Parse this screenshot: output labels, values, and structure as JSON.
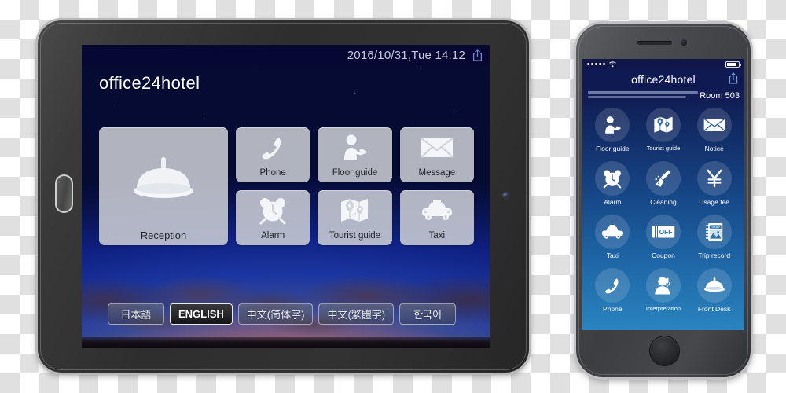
{
  "tablet": {
    "status_bar": {
      "datetime": "2016/10/31,Tue 14:12",
      "share_icon": "share-icon"
    },
    "brand": "office24hotel",
    "tiles": [
      {
        "label": "Reception",
        "icon": "service-bell-icon",
        "size": "large"
      },
      {
        "label": "Phone",
        "icon": "phone-handset-icon",
        "size": "small"
      },
      {
        "label": "Floor guide",
        "icon": "concierge-person-icon",
        "size": "small"
      },
      {
        "label": "Message",
        "icon": "envelope-icon",
        "size": "small"
      },
      {
        "label": "Alarm",
        "icon": "alarm-clock-icon",
        "size": "small"
      },
      {
        "label": "Tourist guide",
        "icon": "map-pins-icon",
        "size": "small"
      },
      {
        "label": "Taxi",
        "icon": "taxi-car-icon",
        "size": "small"
      }
    ],
    "languages": [
      {
        "label": "日本語",
        "selected": false
      },
      {
        "label": "ENGLISH",
        "selected": true
      },
      {
        "label": "中文(简体字)",
        "selected": false
      },
      {
        "label": "中文(繁體字)",
        "selected": false
      },
      {
        "label": "한국어",
        "selected": false
      }
    ]
  },
  "phone": {
    "status_bar": {
      "signal_dots": 5,
      "wifi_icon": "wifi-icon",
      "battery_icon": "battery-icon"
    },
    "nav": {
      "title": "office24hotel",
      "share_icon": "share-icon"
    },
    "room": "Room 503",
    "tiles": [
      {
        "label": "Floor guide",
        "icon": "concierge-person-icon"
      },
      {
        "label": "Tourist guide",
        "icon": "map-pins-icon"
      },
      {
        "label": "Notice",
        "icon": "envelope-icon"
      },
      {
        "label": "Alarm",
        "icon": "alarm-clock-icon"
      },
      {
        "label": "Cleaning",
        "icon": "broom-icon"
      },
      {
        "label": "Usage fee",
        "icon": "yen-icon"
      },
      {
        "label": "Taxi",
        "icon": "taxi-car-icon"
      },
      {
        "label": "Coupon",
        "icon": "coupon-off-ticket-icon",
        "icon_text": "OFF"
      },
      {
        "label": "Trip record",
        "icon": "diary-notebook-icon",
        "icon_text": "DIARY"
      },
      {
        "label": "Phone",
        "icon": "phone-handset-icon"
      },
      {
        "label": "Interpretation",
        "icon": "person-microphone-icon"
      },
      {
        "label": "Front Desk",
        "icon": "service-bell-icon"
      }
    ]
  },
  "colors": {
    "tablet_statusbar": "#070733",
    "tile_face": "#ced1d6",
    "phone_navbar": "#101a52",
    "phone_gradient_top": "#0b1038",
    "phone_gradient_bottom": "#2a84bf",
    "lang_active": "#161618"
  }
}
